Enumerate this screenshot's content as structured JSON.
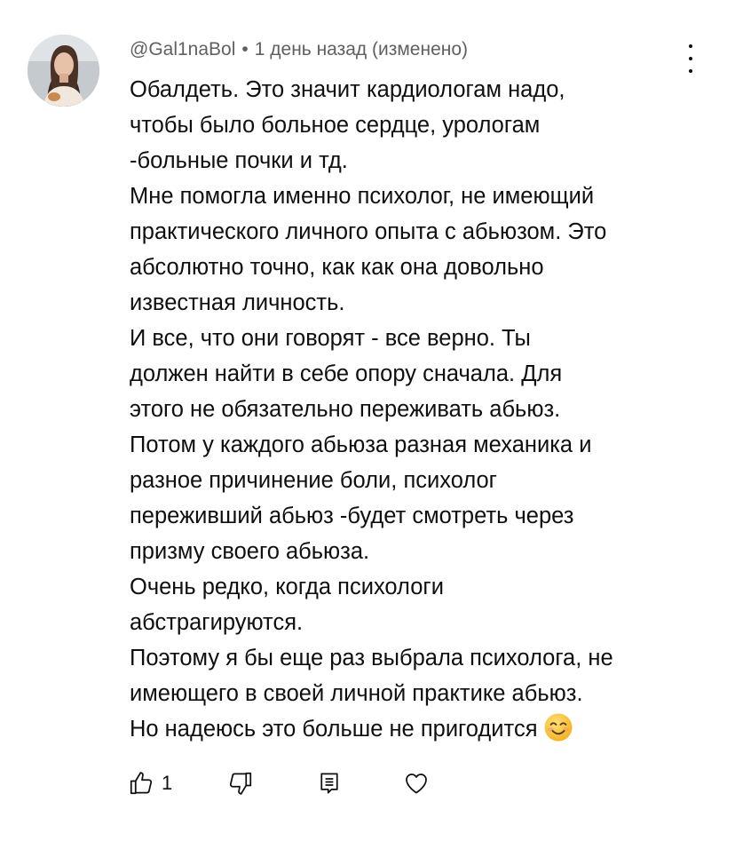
{
  "comment": {
    "author": "@Gal1naBol",
    "separator": "•",
    "timestamp": "1 день назад (изменено)",
    "lines": [
      "Обалдеть. Это значит кардиологам надо,",
      "чтобы было больное сердце, урологам",
      "-больные почки и тд.",
      "Мне помогла именно психолог, не имеющий",
      "практического личного опыта с абьюзом. Это",
      "абсолютно точно, как как она довольно",
      "известная личность.",
      "И все, что они говорят - все верно. Ты",
      "должен найти в себе опору сначала. Для",
      "этого не обязательно переживать абьюз.",
      "Потом у каждого абьюза разная механика и",
      "разное причинение боли, психолог",
      "переживший абьюз -будет смотреть через",
      "призму своего абьюза.",
      "Очень редко, когда психологи",
      "абстрагируются.",
      "Поэтому я бы еще раз выбрала психолога, не",
      "имеющего в своей личной практике абьюз.",
      "Но надеюсь это больше не пригодится"
    ],
    "trailing_emoji": "smiling-face-emoji",
    "like_count": "1"
  },
  "icons": {
    "menu": "more-vertical-icon",
    "like": "thumb-up-icon",
    "dislike": "thumb-down-icon",
    "reply": "reply-comment-icon",
    "heart": "heart-icon"
  },
  "colors": {
    "text": "#0f0f0f",
    "meta": "#606060",
    "background": "#ffffff",
    "emoji": "#ffcc33"
  }
}
